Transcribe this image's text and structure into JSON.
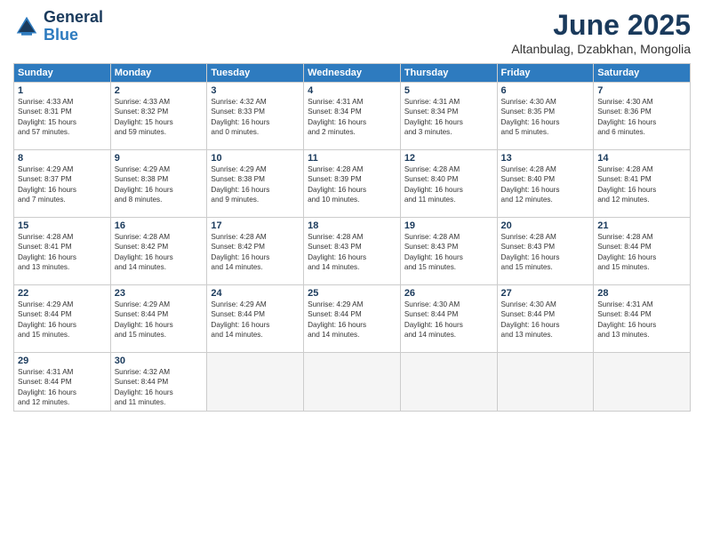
{
  "logo": {
    "line1": "General",
    "line2": "Blue"
  },
  "title": "June 2025",
  "location": "Altanbulag, Dzabkhan, Mongolia",
  "headers": [
    "Sunday",
    "Monday",
    "Tuesday",
    "Wednesday",
    "Thursday",
    "Friday",
    "Saturday"
  ],
  "weeks": [
    [
      {
        "day": "1",
        "info": "Sunrise: 4:33 AM\nSunset: 8:31 PM\nDaylight: 15 hours\nand 57 minutes."
      },
      {
        "day": "2",
        "info": "Sunrise: 4:33 AM\nSunset: 8:32 PM\nDaylight: 15 hours\nand 59 minutes."
      },
      {
        "day": "3",
        "info": "Sunrise: 4:32 AM\nSunset: 8:33 PM\nDaylight: 16 hours\nand 0 minutes."
      },
      {
        "day": "4",
        "info": "Sunrise: 4:31 AM\nSunset: 8:34 PM\nDaylight: 16 hours\nand 2 minutes."
      },
      {
        "day": "5",
        "info": "Sunrise: 4:31 AM\nSunset: 8:34 PM\nDaylight: 16 hours\nand 3 minutes."
      },
      {
        "day": "6",
        "info": "Sunrise: 4:30 AM\nSunset: 8:35 PM\nDaylight: 16 hours\nand 5 minutes."
      },
      {
        "day": "7",
        "info": "Sunrise: 4:30 AM\nSunset: 8:36 PM\nDaylight: 16 hours\nand 6 minutes."
      }
    ],
    [
      {
        "day": "8",
        "info": "Sunrise: 4:29 AM\nSunset: 8:37 PM\nDaylight: 16 hours\nand 7 minutes."
      },
      {
        "day": "9",
        "info": "Sunrise: 4:29 AM\nSunset: 8:38 PM\nDaylight: 16 hours\nand 8 minutes."
      },
      {
        "day": "10",
        "info": "Sunrise: 4:29 AM\nSunset: 8:38 PM\nDaylight: 16 hours\nand 9 minutes."
      },
      {
        "day": "11",
        "info": "Sunrise: 4:28 AM\nSunset: 8:39 PM\nDaylight: 16 hours\nand 10 minutes."
      },
      {
        "day": "12",
        "info": "Sunrise: 4:28 AM\nSunset: 8:40 PM\nDaylight: 16 hours\nand 11 minutes."
      },
      {
        "day": "13",
        "info": "Sunrise: 4:28 AM\nSunset: 8:40 PM\nDaylight: 16 hours\nand 12 minutes."
      },
      {
        "day": "14",
        "info": "Sunrise: 4:28 AM\nSunset: 8:41 PM\nDaylight: 16 hours\nand 12 minutes."
      }
    ],
    [
      {
        "day": "15",
        "info": "Sunrise: 4:28 AM\nSunset: 8:41 PM\nDaylight: 16 hours\nand 13 minutes."
      },
      {
        "day": "16",
        "info": "Sunrise: 4:28 AM\nSunset: 8:42 PM\nDaylight: 16 hours\nand 14 minutes."
      },
      {
        "day": "17",
        "info": "Sunrise: 4:28 AM\nSunset: 8:42 PM\nDaylight: 16 hours\nand 14 minutes."
      },
      {
        "day": "18",
        "info": "Sunrise: 4:28 AM\nSunset: 8:43 PM\nDaylight: 16 hours\nand 14 minutes."
      },
      {
        "day": "19",
        "info": "Sunrise: 4:28 AM\nSunset: 8:43 PM\nDaylight: 16 hours\nand 15 minutes."
      },
      {
        "day": "20",
        "info": "Sunrise: 4:28 AM\nSunset: 8:43 PM\nDaylight: 16 hours\nand 15 minutes."
      },
      {
        "day": "21",
        "info": "Sunrise: 4:28 AM\nSunset: 8:44 PM\nDaylight: 16 hours\nand 15 minutes."
      }
    ],
    [
      {
        "day": "22",
        "info": "Sunrise: 4:29 AM\nSunset: 8:44 PM\nDaylight: 16 hours\nand 15 minutes."
      },
      {
        "day": "23",
        "info": "Sunrise: 4:29 AM\nSunset: 8:44 PM\nDaylight: 16 hours\nand 15 minutes."
      },
      {
        "day": "24",
        "info": "Sunrise: 4:29 AM\nSunset: 8:44 PM\nDaylight: 16 hours\nand 14 minutes."
      },
      {
        "day": "25",
        "info": "Sunrise: 4:29 AM\nSunset: 8:44 PM\nDaylight: 16 hours\nand 14 minutes."
      },
      {
        "day": "26",
        "info": "Sunrise: 4:30 AM\nSunset: 8:44 PM\nDaylight: 16 hours\nand 14 minutes."
      },
      {
        "day": "27",
        "info": "Sunrise: 4:30 AM\nSunset: 8:44 PM\nDaylight: 16 hours\nand 13 minutes."
      },
      {
        "day": "28",
        "info": "Sunrise: 4:31 AM\nSunset: 8:44 PM\nDaylight: 16 hours\nand 13 minutes."
      }
    ],
    [
      {
        "day": "29",
        "info": "Sunrise: 4:31 AM\nSunset: 8:44 PM\nDaylight: 16 hours\nand 12 minutes."
      },
      {
        "day": "30",
        "info": "Sunrise: 4:32 AM\nSunset: 8:44 PM\nDaylight: 16 hours\nand 11 minutes."
      },
      {
        "day": "",
        "info": ""
      },
      {
        "day": "",
        "info": ""
      },
      {
        "day": "",
        "info": ""
      },
      {
        "day": "",
        "info": ""
      },
      {
        "day": "",
        "info": ""
      }
    ]
  ]
}
